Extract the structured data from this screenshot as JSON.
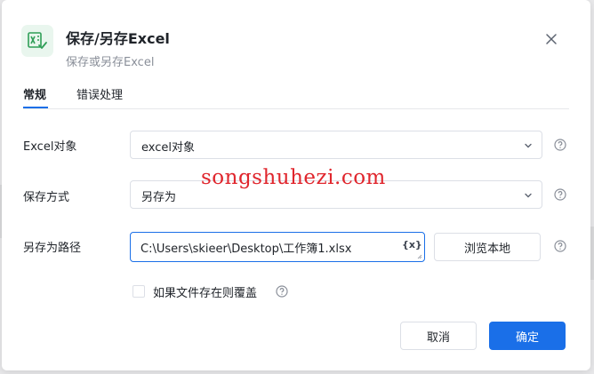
{
  "dialog": {
    "title": "保存/另存Excel",
    "subtitle": "保存或另存Excel",
    "app_icon": "excel-save-icon",
    "close_icon": "close-icon"
  },
  "tabs": [
    {
      "label": "常规",
      "active": true
    },
    {
      "label": "错误处理",
      "active": false
    }
  ],
  "form": {
    "excel_object": {
      "label": "Excel对象",
      "value": "excel对象"
    },
    "save_mode": {
      "label": "保存方式",
      "value": "另存为"
    },
    "save_path": {
      "label": "另存为路径",
      "value": "C:\\Users\\skieer\\Desktop\\工作簿1.xlsx",
      "variable_icon": "{x}",
      "browse_label": "浏览本地"
    },
    "overwrite": {
      "label": "如果文件存在则覆盖",
      "checked": false
    }
  },
  "footer": {
    "cancel_label": "取消",
    "confirm_label": "确定"
  },
  "watermark": "songshuhezi.com",
  "colors": {
    "primary": "#1a6fe8",
    "icon_green": "#2f9e57",
    "watermark": "#e0262d"
  }
}
